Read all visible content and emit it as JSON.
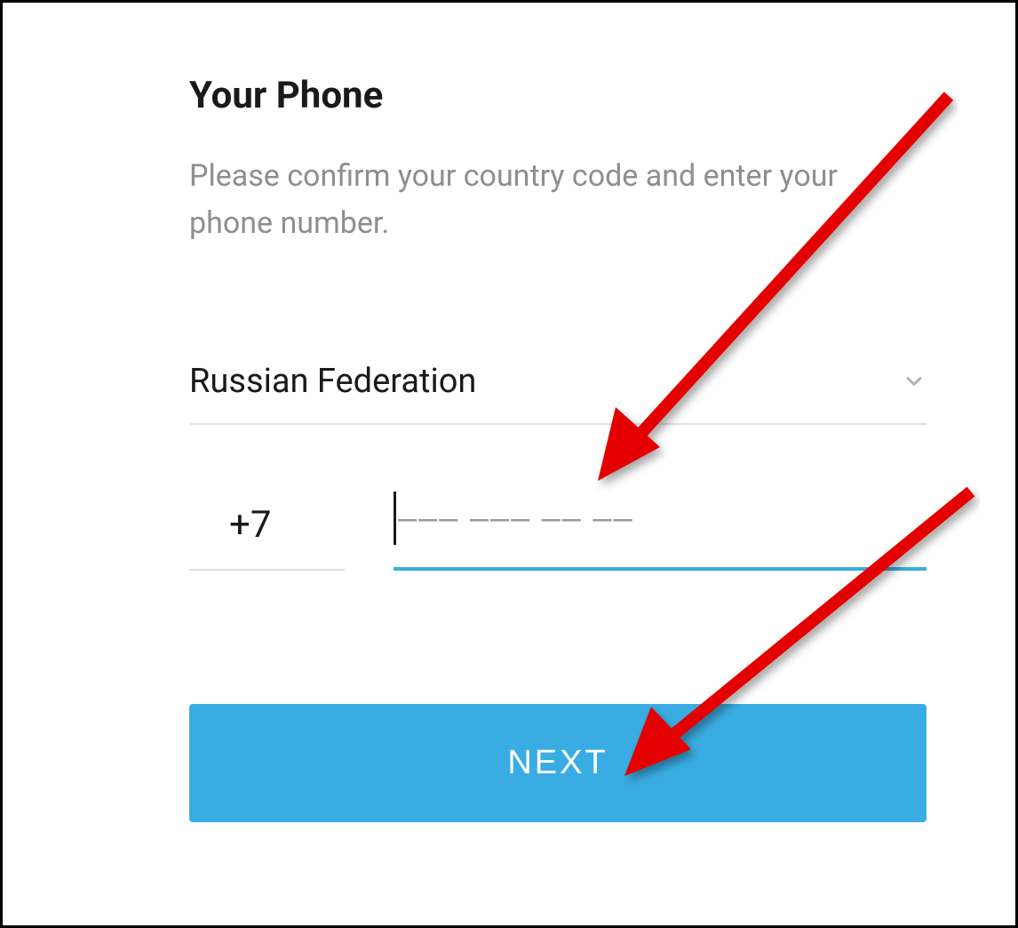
{
  "header": {
    "title": "Your Phone",
    "subtitle": "Please confirm your country code and enter your phone number."
  },
  "country": {
    "name": "Russian Federation",
    "code": "+7"
  },
  "phone": {
    "placeholder": "‒‒‒ ‒‒‒ ‒‒ ‒‒",
    "value": ""
  },
  "buttons": {
    "next": "NEXT"
  }
}
